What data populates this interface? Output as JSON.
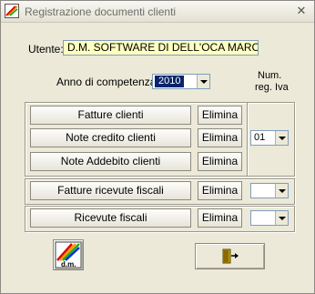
{
  "window": {
    "title": "Registrazione documenti clienti",
    "close_glyph": "✕"
  },
  "utente": {
    "label": "Utente:",
    "value": "D.M. SOFTWARE DI DELL'OCA MARCO"
  },
  "anno": {
    "label": "Anno di competenza:",
    "value": "2010"
  },
  "num_reg": {
    "header_line1": "Num.",
    "header_line2": "reg. Iva"
  },
  "rows": [
    {
      "label": "Fatture clienti",
      "delete": "Elimina"
    },
    {
      "label": "Note credito clienti",
      "delete": "Elimina",
      "reg_value": "01"
    },
    {
      "label": "Note Addebito clienti",
      "delete": "Elimina"
    },
    {
      "label": "Fatture ricevute fiscali",
      "delete": "Elimina",
      "reg_value": ""
    },
    {
      "label": "Ricevute fiscali",
      "delete": "Elimina",
      "reg_value": ""
    }
  ],
  "buttons": {
    "logo_text": "d.m.",
    "logo_icon": "dm-logo-icon",
    "exit_icon": "exit-door-icon"
  },
  "colors": {
    "field_bg": "#ffffc0",
    "window_bg": "#ece9d8"
  }
}
